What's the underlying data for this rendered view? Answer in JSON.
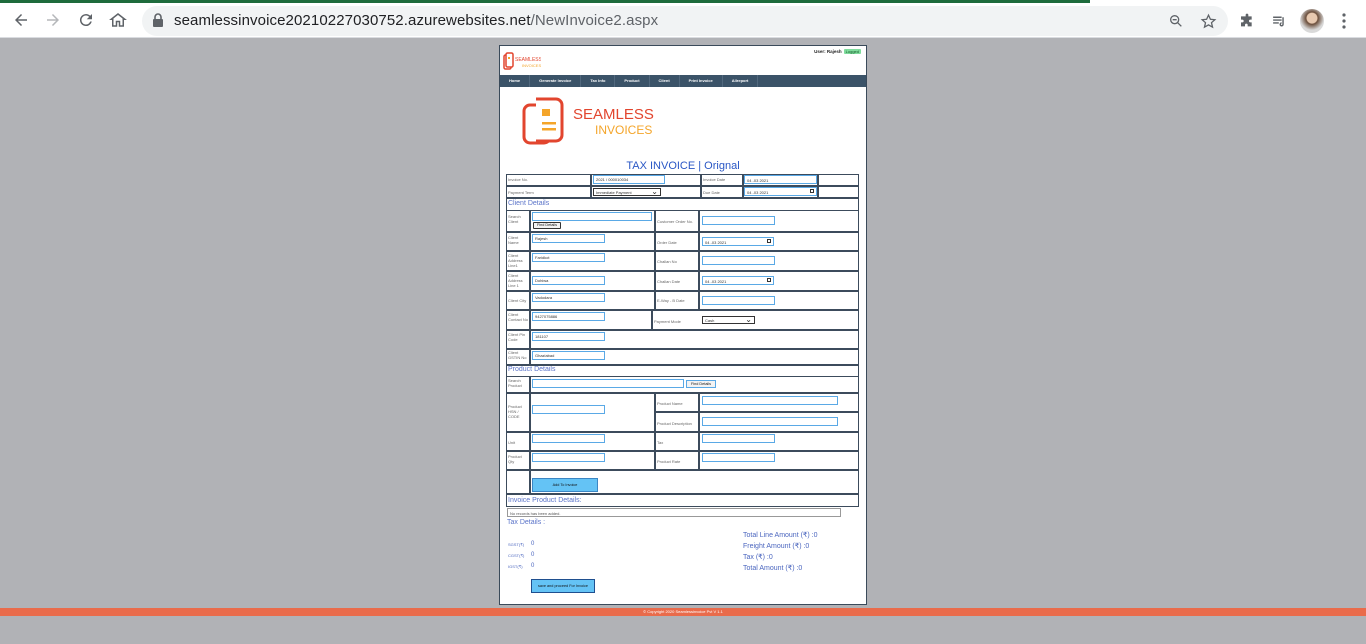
{
  "browser": {
    "url_host": "seamlessinvoice20210227030752.azurewebsites.net",
    "url_path": "/NewInvoice2.aspx"
  },
  "header": {
    "user_text": "User: Rajesh",
    "logged_badge": "Logged",
    "logo_text_1": "SEAMLESS",
    "logo_text_2": "INVOICES"
  },
  "menu": [
    "Home",
    "Generate Invoice",
    "Tax Info",
    "Product",
    "Client",
    "Print Invoice",
    "Allreport"
  ],
  "invoice": {
    "title": "TAX INVOICE | Orignal",
    "invoice_no_label": "Invoice No.",
    "invoice_no_value": "2021 / 000010034",
    "invoice_date_label": "Invoice Date",
    "invoice_date_value": "04 -03 2021",
    "payment_term_label": "Payment Term",
    "payment_term_value": "Immediate Payment",
    "due_date_label": "Due Date",
    "due_date_value": "04 -03 2021"
  },
  "client": {
    "section_title": "Client Details",
    "search_label": "Search Client",
    "find_button": "Find Details",
    "customer_order_label": "Customer Order No.",
    "name_label": "Client Name",
    "name_value": "Rajesh",
    "order_date_label": "Order Date",
    "order_date_value": "04 -03 2021",
    "addr1_label": "Client Address Line1",
    "addr1_value": "Faridkot",
    "challan_no_label": "Challan No",
    "addr2_label": "Client Address Line 1",
    "addr2_value": "Dohiwa",
    "challan_date_label": "Challan Date",
    "challan_date_value": "04 -03 2021",
    "city_label": "Client City",
    "city_value": "Vadodara",
    "eway_label": "E-Way - B Date",
    "contact_label": "Client Contact No",
    "contact_value": "9427075886",
    "payment_mode_label": "Payment Mode",
    "payment_mode_value": "Cash",
    "pin_label": "Client Pin Code",
    "pin_value": "181107",
    "gstin_label": "Client GSTIN No",
    "gstin_value": "Ghaziabad"
  },
  "product": {
    "section_title": "Product Details",
    "search_label": "Search Product",
    "find_button": "Find Details",
    "hsn_label": "Product HSN / CODE",
    "name_label": "Product Name",
    "desc_label": "Product Description",
    "unit_label": "Unit",
    "tax_label": "Tax",
    "qty_label": "Product Qty",
    "rate_label": "Product Rate",
    "add_button": "Add To Invoice"
  },
  "invoice_products": {
    "section_title": "Invoice Product Details:",
    "empty_text": "No records has been added."
  },
  "tax": {
    "section_title": "Tax Details :",
    "sgst_label": "SGST(₹)",
    "sgst_value": "0",
    "cgst_label": "CGST(₹)",
    "cgst_value": "0",
    "igst_label": "IGST(₹)",
    "igst_value": "0",
    "total_line": "Total Line Amount (₹) :0",
    "freight": "Freight Amount (₹) :0",
    "tax_amount": "Tax  (₹) :0",
    "total_amount": "Total Amount (₹) :0"
  },
  "save_button": "save and proceed For Invoice",
  "footer_text": "© Copyright 2020 Seamlessinvoice Pvt V 1.1",
  "colors": {
    "menu_bg": "#3b5368",
    "accent_blue": "#2a57c5",
    "footer": "#e96b4b",
    "button_blue": "#64c3f5"
  }
}
